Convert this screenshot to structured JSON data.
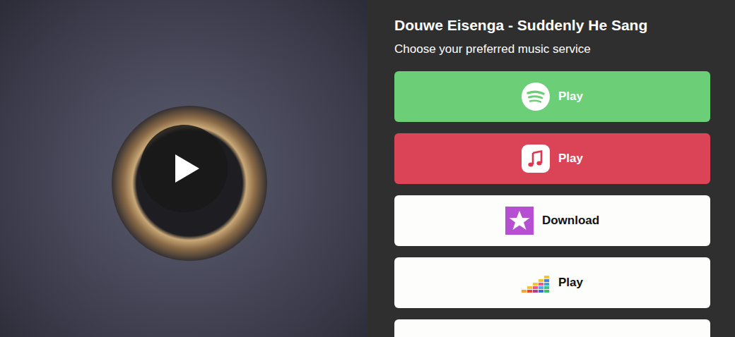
{
  "page": {
    "title": "Douwe Eisenga - Suddenly He Sang",
    "subtitle": "Choose your preferred music service"
  },
  "services": [
    {
      "kind": "spotify",
      "label": "Play",
      "color": "#6ccf78"
    },
    {
      "kind": "apple-music",
      "label": "Play",
      "color": "#db4457"
    },
    {
      "kind": "itunes",
      "label": "Download",
      "color": "#fdfdfc"
    },
    {
      "kind": "deezer",
      "label": "Play",
      "color": "#fdfdfc"
    },
    {
      "kind": "blank",
      "label": "",
      "color": "#fdfdfc"
    }
  ]
}
